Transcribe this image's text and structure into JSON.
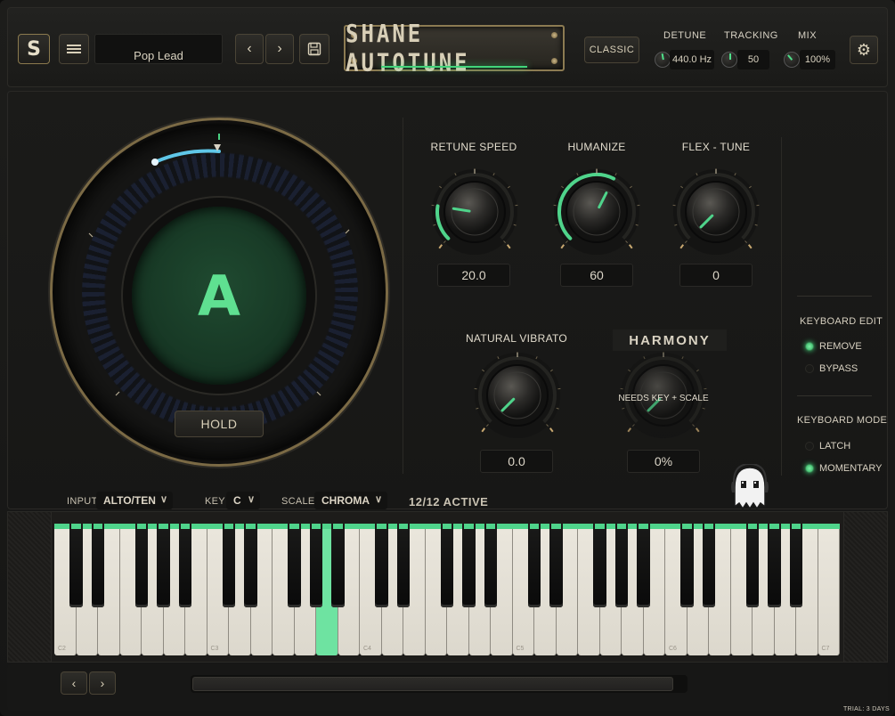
{
  "header": {
    "logo_letter": "S",
    "preset_name": "Pop Lead",
    "title": "SHANE AUTOTUNE",
    "mode_button": "CLASSIC",
    "detune": {
      "label": "DETUNE",
      "value": "440.0 Hz"
    },
    "tracking": {
      "label": "TRACKING",
      "value": "50"
    },
    "mix": {
      "label": "MIX",
      "value": "100%"
    }
  },
  "tuner": {
    "note": "A",
    "hold_label": "HOLD"
  },
  "knobs": {
    "retune_speed": {
      "label": "RETUNE SPEED",
      "value": "20.0",
      "level": 0.2
    },
    "humanize": {
      "label": "HUMANIZE",
      "value": "60",
      "level": 0.6
    },
    "flex_tune": {
      "label": "FLEX - TUNE",
      "value": "0",
      "level": 0.0
    },
    "natural_vibrato": {
      "label": "NATURAL VIBRATO",
      "value": "0.0",
      "level": 0.0
    },
    "harmony": {
      "title": "HARMONY",
      "overlay": "NEEDS KEY + SCALE",
      "value": "0%",
      "level": 0.0
    }
  },
  "keyboard_edit": {
    "title": "KEYBOARD EDIT",
    "options": [
      "REMOVE",
      "BYPASS"
    ],
    "selected": "REMOVE"
  },
  "keyboard_mode": {
    "title": "KEYBOARD MODE",
    "options": [
      "LATCH",
      "MOMENTARY"
    ],
    "selected": "MOMENTARY"
  },
  "selectors": {
    "input": {
      "label": "INPUT",
      "value": "ALTO/TEN"
    },
    "key": {
      "label": "KEY",
      "value": "C"
    },
    "scale": {
      "label": "SCALE",
      "value": "CHROMA"
    },
    "active": "12/12 ACTIVE"
  },
  "piano": {
    "octave_labels": [
      "C2",
      "C3",
      "C4",
      "C5",
      "C6",
      "C7"
    ],
    "highlighted_note": "A3"
  },
  "footer": {
    "trial": "TRIAL: 3 DAYS"
  },
  "colors": {
    "accent_green": "#4fd48b",
    "brass": "#8c7b52",
    "tuner_arc": "#5fc7e8"
  },
  "icons": [
    "menu-icon",
    "chevron-left-icon",
    "chevron-right-icon",
    "save-icon",
    "gear-icon",
    "ghost-mascot-icon"
  ]
}
